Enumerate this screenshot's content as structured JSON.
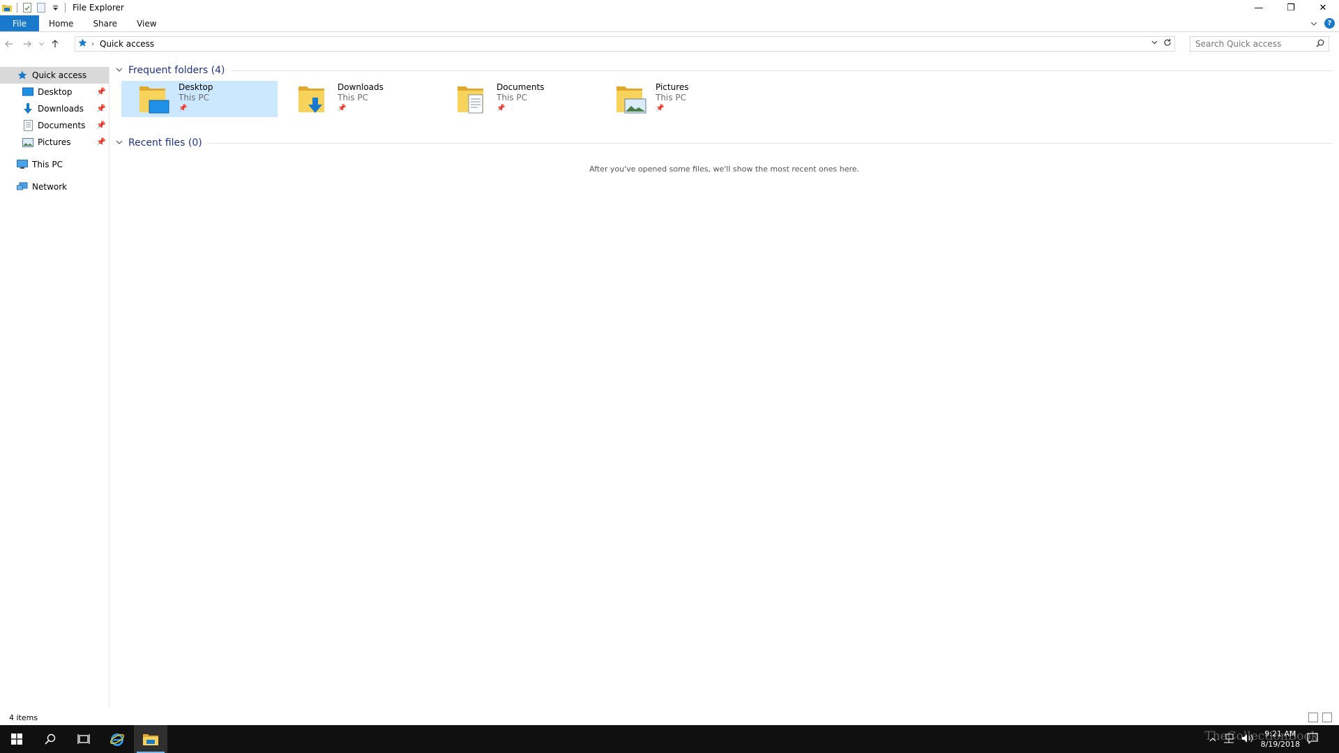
{
  "window": {
    "title": "File Explorer",
    "minimize_glyph": "—",
    "restore_glyph": "❐",
    "close_glyph": "✕"
  },
  "ribbon": {
    "tabs": [
      {
        "label": "File"
      },
      {
        "label": "Home"
      },
      {
        "label": "Share"
      },
      {
        "label": "View"
      }
    ],
    "help_label": "?"
  },
  "address": {
    "location": "Quick access",
    "search_placeholder": "Search Quick access"
  },
  "nav": {
    "quick_access": "Quick access",
    "pinned": [
      {
        "label": "Desktop"
      },
      {
        "label": "Downloads"
      },
      {
        "label": "Documents"
      },
      {
        "label": "Pictures"
      }
    ],
    "this_pc": "This PC",
    "network": "Network"
  },
  "frequent": {
    "header": "Frequent folders (4)",
    "folders": [
      {
        "name": "Desktop",
        "location": "This PC"
      },
      {
        "name": "Downloads",
        "location": "This PC"
      },
      {
        "name": "Documents",
        "location": "This PC"
      },
      {
        "name": "Pictures",
        "location": "This PC"
      }
    ]
  },
  "recent": {
    "header": "Recent files (0)",
    "empty_message": "After you've opened some files, we'll show the most recent ones here."
  },
  "status": {
    "item_count": "4 items"
  },
  "taskbar": {
    "time": "9:21 AM",
    "date": "8/19/2018",
    "watermark": "TheCollectionBook"
  },
  "colors": {
    "accent": "#1979ca",
    "selection": "#cce8ff",
    "group_header": "#1e3287",
    "taskbar": "#101010"
  }
}
